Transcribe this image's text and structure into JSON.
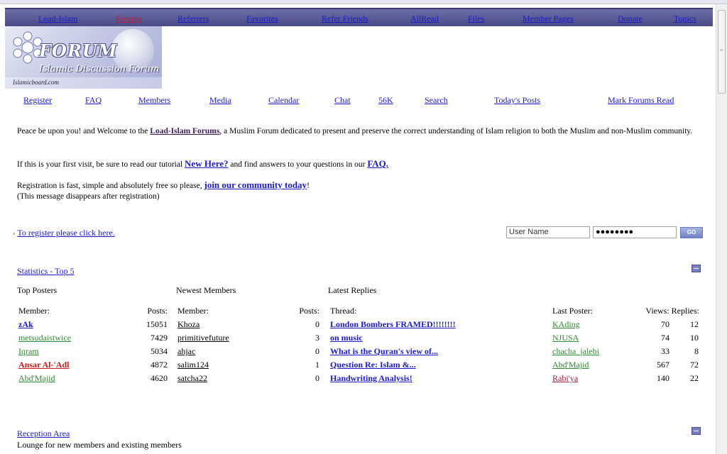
{
  "topnav": {
    "items": [
      {
        "label": "Load-Islam"
      },
      {
        "label": "Forums"
      },
      {
        "label": "Referrers"
      },
      {
        "label": "Favorites"
      },
      {
        "label": "Refer Friends"
      },
      {
        "label": "AllRead"
      },
      {
        "label": "Files"
      },
      {
        "label": "Member Pages"
      },
      {
        "label": "Donate"
      },
      {
        "label": "Topics"
      }
    ]
  },
  "logo": {
    "title": "FORUM",
    "subtitle": "Islamic Discussion Forum",
    "domain": "Islamicboard.com"
  },
  "subnav": {
    "items": [
      {
        "label": "Register"
      },
      {
        "label": "FAQ"
      },
      {
        "label": "Members"
      },
      {
        "label": "Media"
      },
      {
        "label": "Calendar"
      },
      {
        "label": "Chat"
      },
      {
        "label": "56K"
      },
      {
        "label": "Search"
      },
      {
        "label": "Today's Posts"
      },
      {
        "label": "Mark Forums Read"
      }
    ]
  },
  "welcome": {
    "p1_a": "Peace be upon you! and Welcome to the ",
    "p1_link": "Load-Islam Forums",
    "p1_b": ", a Muslim Forum dedicated to present and preserve the correct understanding of Islam religion to both the Muslim and non-Muslim community.",
    "p2_a": "If this is your first visit, be sure to read our tutorial ",
    "p2_link1": "New Here?",
    "p2_b": " and find answers to your questions in our ",
    "p2_link2": "FAQ.",
    "p3_a": "Registration is fast, simple and absolutely free so please, ",
    "p3_link": "join our community today",
    "p3_b": "!",
    "p3_note": "(This message disappears after registration)"
  },
  "login": {
    "register_link": "To register please click here.",
    "username_value": "User Name",
    "password_value": "●●●●●●●●",
    "go_label": "GO"
  },
  "statistics": {
    "title": "Statistics - Top 5",
    "top_posters": {
      "heading": "Top Posters",
      "col_member": "Member:",
      "col_posts": "Posts:",
      "rows": [
        {
          "member": "zAk",
          "posts": "15051"
        },
        {
          "member": "metsudaistwice",
          "posts": "7429"
        },
        {
          "member": "Iqram",
          "posts": "5034"
        },
        {
          "member": "Ansar Al-'Adl",
          "posts": "4872"
        },
        {
          "member": "Abd'Majid",
          "posts": "4620"
        }
      ]
    },
    "newest_members": {
      "heading": "Newest Members",
      "col_member": "Member:",
      "col_posts": "Posts:",
      "rows": [
        {
          "member": "Khoza",
          "posts": "0"
        },
        {
          "member": "primitivefuture",
          "posts": "3"
        },
        {
          "member": "ahjac",
          "posts": "0"
        },
        {
          "member": "salim124",
          "posts": "1"
        },
        {
          "member": "satcha22",
          "posts": "0"
        }
      ]
    },
    "latest_replies": {
      "heading": "Latest Replies",
      "col_thread": "Thread:",
      "col_last_poster": "Last Poster:",
      "col_views_replies": "Views: Replies:",
      "rows": [
        {
          "thread": "London Bombers FRAMED!!!!!!!!",
          "last_poster": "KAding",
          "views": "70",
          "replies": "12"
        },
        {
          "thread": "on music",
          "last_poster": "NJUSA",
          "views": "74",
          "replies": "10"
        },
        {
          "thread": "What is the Quran's view of...",
          "last_poster": "chacha_jalebi",
          "views": "33",
          "replies": "8"
        },
        {
          "thread": "Question Re: Islam &...",
          "last_poster": "Abd'Majid",
          "views": "567",
          "replies": "72"
        },
        {
          "thread": "Handwriting Analysis!",
          "last_poster": "Rabi'ya",
          "views": "140",
          "replies": "22"
        }
      ]
    }
  },
  "reception": {
    "title": "Reception Area",
    "description": "Lounge for new members and existing members"
  }
}
